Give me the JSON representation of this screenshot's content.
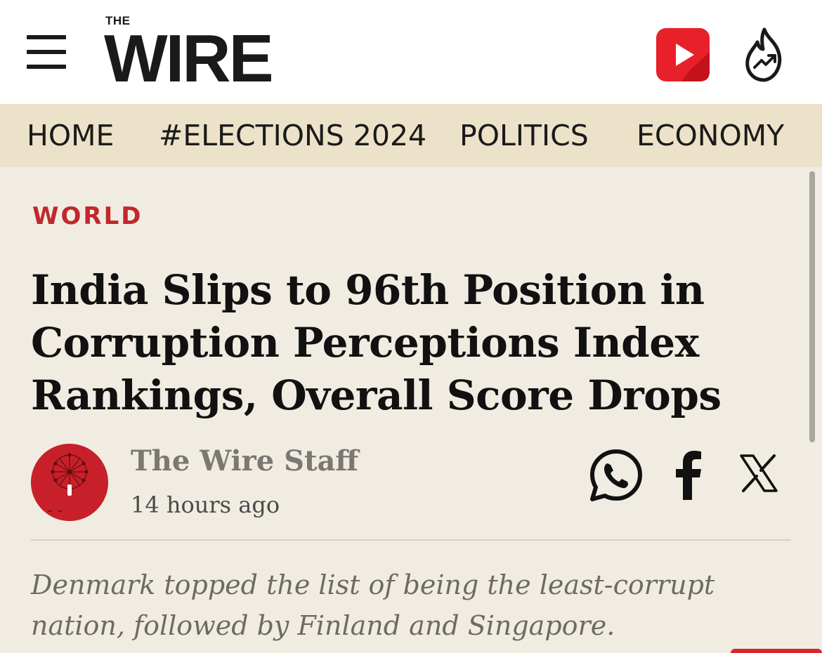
{
  "header": {
    "logo_the": "THE",
    "logo_wire": "WIRE",
    "menu_icon": "hamburger-menu-icon",
    "video_icon": "youtube-play-icon",
    "trending_icon": "trending-flame-icon"
  },
  "nav": {
    "items": [
      {
        "label": "HOME"
      },
      {
        "label": "#ELECTIONS 2024"
      },
      {
        "label": "POLITICS"
      },
      {
        "label": "ECONOMY"
      }
    ]
  },
  "article": {
    "category": "WORLD",
    "headline": "India Slips to 96th Position in Corruption Perceptions Index Rankings, Overall Score Drops",
    "author": "The Wire Staff",
    "time": "14 hours ago",
    "summary": "Denmark topped the list of being the least-corrupt nation, followed by Finland and Singapore."
  },
  "share": {
    "icons": [
      "whatsapp-icon",
      "facebook-icon",
      "x-icon"
    ]
  },
  "colors": {
    "accent_red": "#c0282d",
    "nav_background": "#ece2c9",
    "page_background": "#f1ece2"
  }
}
